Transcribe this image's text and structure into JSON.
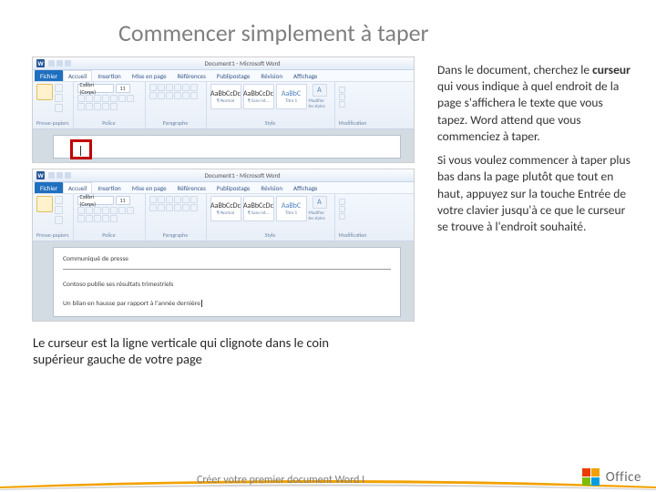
{
  "slide": {
    "title": "Commencer simplement à taper",
    "caption": "Le curseur est la ligne verticale qui clignote dans le coin supérieur gauche de votre page",
    "footer_title": "Créer votre premier document Word I"
  },
  "body": {
    "para1_prefix": "Dans le document, cherchez le ",
    "para1_bold": "curseur",
    "para1_suffix": " qui vous indique à quel endroit de la page s'affichera le texte que vous tapez. Word attend que vous commenciez à taper.",
    "para2": "Si vous voulez commencer à taper plus bas dans la page plutôt que tout en haut, appuyez sur la touche Entrée de votre clavier jusqu'à ce que le curseur se trouve à l'endroit souhaité."
  },
  "word": {
    "titlebar": "Document1 - Microsoft Word",
    "tabs": {
      "fichier": "Fichier",
      "accueil": "Accueil",
      "insertion": "Insertion",
      "miseenpage": "Mise en page",
      "references": "Références",
      "publipostage": "Publipostage",
      "revision": "Révision",
      "affichage": "Affichage"
    },
    "groups": {
      "pressepapiers": "Presse-papiers",
      "police": "Police",
      "paragraphe": "Paragraphe",
      "style": "Style",
      "modification": "Modification"
    },
    "font_name": "Calibri (Corps)",
    "font_size": "11",
    "styles": {
      "normal_prev": "AaBbCcDc",
      "normal_label": "¶ Normal",
      "sansint_prev": "AaBbCcDc",
      "sansint_label": "¶ Sans int…",
      "titre1_prev": "AaBbC",
      "titre1_label": "Titre 1"
    },
    "mod_label": "Modifier les styles"
  },
  "doc2": {
    "line1": "Communiqué de presse",
    "line2": "Contoso publie ses résultats trimestriels",
    "line3": "Un bilan en hausse par rapport à l'année dernière"
  },
  "brand": {
    "name": "Office"
  }
}
